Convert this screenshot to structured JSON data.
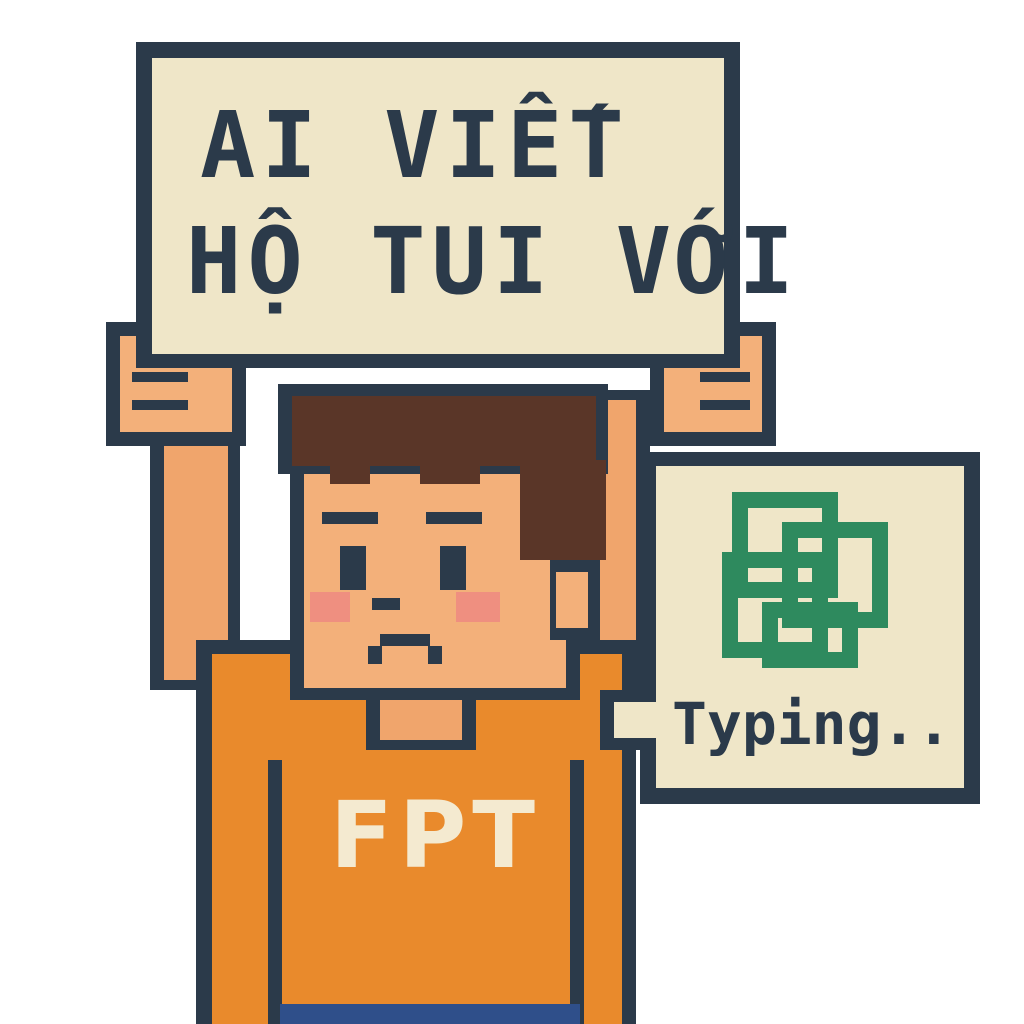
{
  "top_sign": {
    "line1": "AI VIẾT",
    "line2": "HỘ TUI VỚI"
  },
  "shirt": {
    "text": "FPT"
  },
  "side_sign": {
    "status": "Typing...",
    "logo": "openai-logo"
  },
  "colors": {
    "outline": "#2b3a4a",
    "paper": "#efe6c8",
    "shirt": "#e98a2c",
    "skin": "#f3b07a",
    "hair": "#5a3628",
    "logo": "#2e8a5e",
    "cheek": "#ef8f80"
  }
}
